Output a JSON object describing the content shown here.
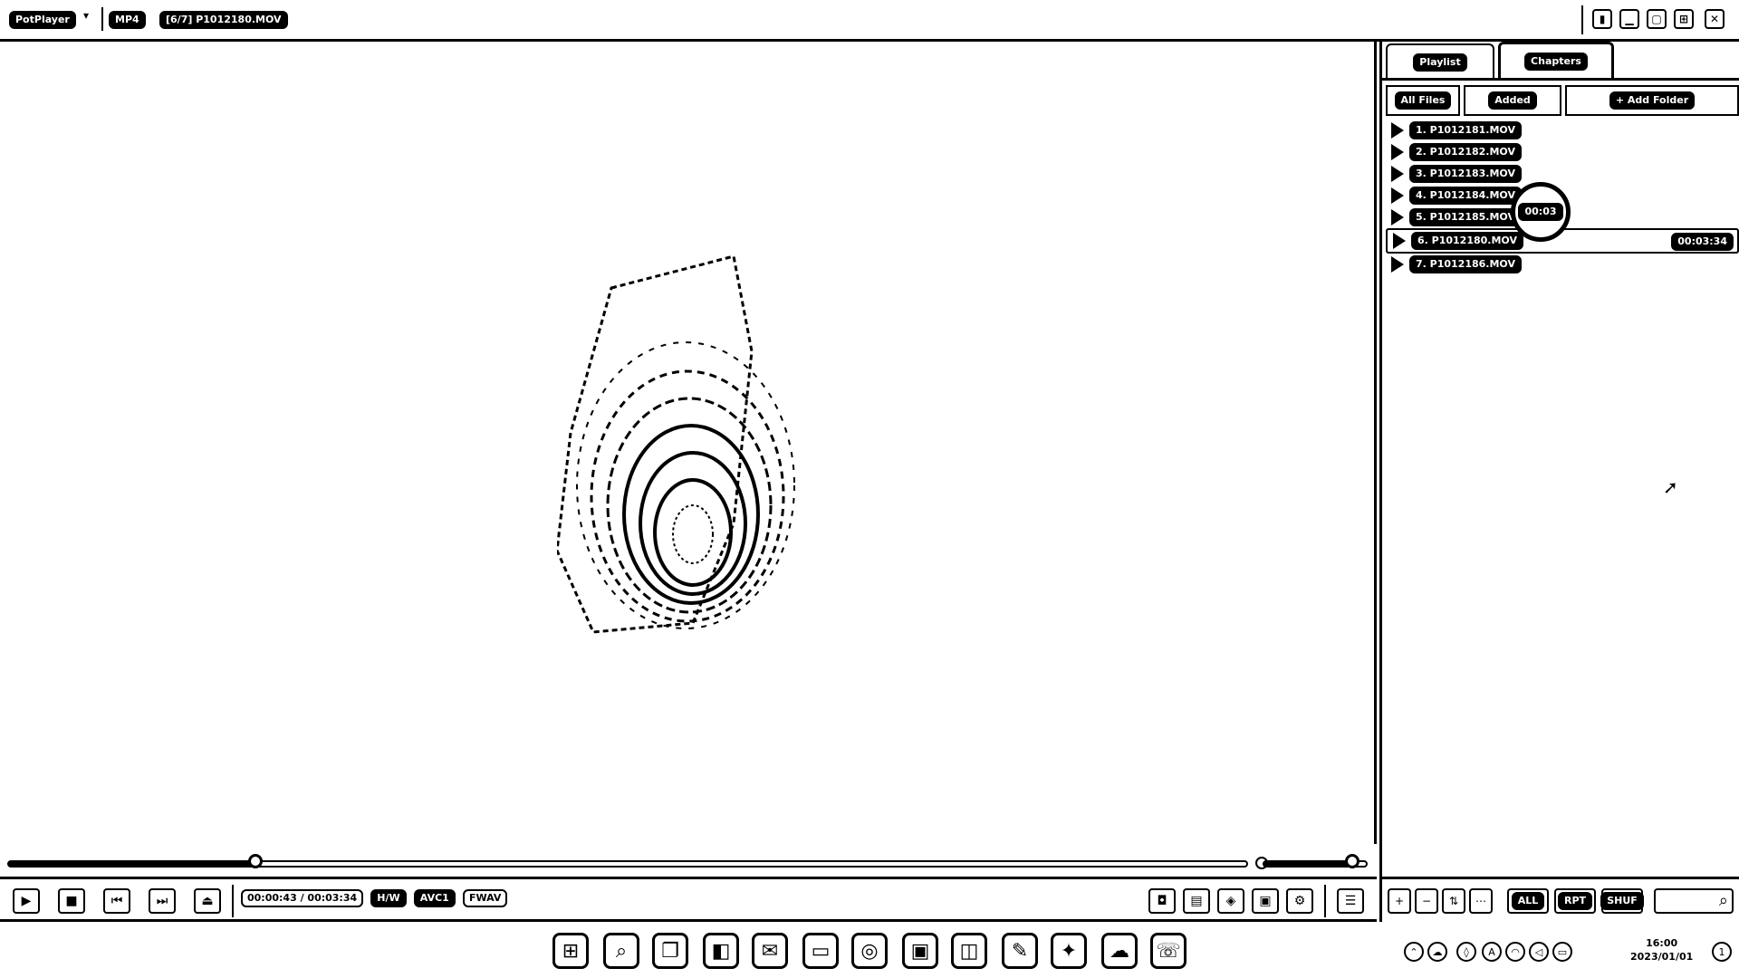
{
  "titlebar": {
    "app_name": "PotPlayer",
    "format_badge": "MP4",
    "file_label": "[6/7] P1012180.MOV",
    "buttons": [
      "pin",
      "minimize",
      "maximize",
      "fullscreen",
      "close"
    ]
  },
  "video": {
    "content": "thumbprint-on-glass"
  },
  "player": {
    "progress": 0.2,
    "volume": 0.85,
    "time_current": "00:00:43",
    "time_total": "00:03:34",
    "badges": [
      "H/W",
      "AVC1",
      "FWAV"
    ],
    "buttons": [
      "play",
      "stop",
      "previous",
      "next",
      "open"
    ],
    "right_buttons": [
      "capture",
      "subtitle",
      "3d",
      "screen",
      "settings",
      "playlist-toggle"
    ]
  },
  "panel": {
    "tabs": [
      {
        "label": "Playlist"
      },
      {
        "label": "Chapters"
      }
    ],
    "subtabs": [
      {
        "label": "All Files"
      },
      {
        "label": "Added"
      },
      {
        "label": "+ Add Folder"
      }
    ],
    "playlist": [
      {
        "title": "1. P1012181.MOV",
        "duration": ""
      },
      {
        "title": "2. P1012182.MOV",
        "duration": ""
      },
      {
        "title": "3. P1012183.MOV",
        "duration": ""
      },
      {
        "title": "4. P1012184.MOV",
        "duration": ""
      },
      {
        "title": "5. P1012185.MOV",
        "duration": ""
      },
      {
        "title": "6. P1012180.MOV",
        "duration": "00:03:34"
      },
      {
        "title": "7. P1012186.MOV",
        "duration": ""
      }
    ],
    "active_index": 5,
    "hover_badge": "00:03",
    "footer_buttons": [
      "add",
      "remove",
      "sort",
      "options",
      "ALL",
      "RPT",
      "SHUF"
    ],
    "search_placeholder": ""
  },
  "taskbar": {
    "apps": [
      "start",
      "search",
      "task-view",
      "widgets",
      "mail",
      "explorer",
      "browser",
      "store",
      "photos",
      "notes",
      "pin-tool",
      "cloud",
      "chat"
    ],
    "time": "16:00",
    "date": "2023/01/01"
  }
}
